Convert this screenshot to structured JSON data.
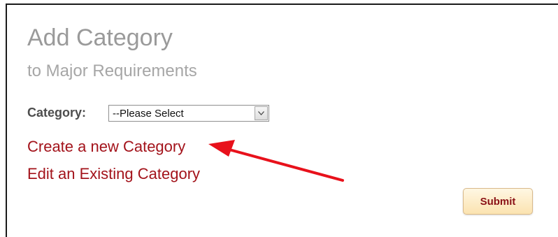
{
  "header": {
    "title": "Add Category",
    "subtitle": "to Major Requirements"
  },
  "form": {
    "category_label": "Category:",
    "category_select": {
      "selected": "--Please Select"
    },
    "links": {
      "create": "Create a new Category",
      "edit": "Edit an Existing Category"
    },
    "submit_label": "Submit"
  },
  "annotation": {
    "arrow_color": "#e8111b"
  },
  "colors": {
    "link": "#a3131b",
    "title": "#9a9a9a",
    "button_text": "#8a1116"
  }
}
